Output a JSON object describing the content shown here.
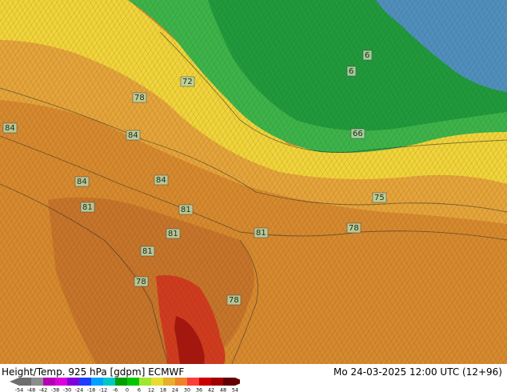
{
  "caption": "Height/Temp. 925 hPa [gdpm] ECMWF",
  "valid_time": "Mo 24-03-2025 12:00 UTC (12+96)",
  "legend": {
    "ticks": [
      "-54",
      "-48",
      "-42",
      "-38",
      "-30",
      "-24",
      "-18",
      "-12",
      "-6",
      "0",
      "6",
      "12",
      "18",
      "24",
      "30",
      "36",
      "42",
      "48",
      "54"
    ],
    "colors": [
      "#6e6e6e",
      "#8c8c8c",
      "#b400b4",
      "#dc00dc",
      "#8200dc",
      "#1e3cff",
      "#00a0ff",
      "#00c8c8",
      "#00a000",
      "#00c800",
      "#a0e632",
      "#e6dc32",
      "#e6af2d",
      "#f08228",
      "#fa3c3c",
      "#c80000",
      "#a00000",
      "#640000"
    ]
  },
  "map": {
    "colors": {
      "cold_blue": "#4f8fbf",
      "green_dark": "#1f9a3c",
      "green": "#3cb44a",
      "yellow": "#f2d43a",
      "orange_light": "#e6a43a",
      "orange": "#d8892e",
      "orange_dark": "#c8742a",
      "red": "#d23a1e",
      "red_dark": "#a8150f"
    },
    "contour_labels": [
      {
        "text": "6"
      },
      {
        "text": "6"
      },
      {
        "text": "72"
      },
      {
        "text": "78"
      },
      {
        "text": "84"
      },
      {
        "text": "84"
      },
      {
        "text": "84"
      },
      {
        "text": "84"
      },
      {
        "text": "81"
      },
      {
        "text": "81"
      },
      {
        "text": "81"
      },
      {
        "text": "81"
      },
      {
        "text": "81"
      },
      {
        "text": "78"
      },
      {
        "text": "78"
      },
      {
        "text": "78"
      },
      {
        "text": "75"
      },
      {
        "text": "66"
      }
    ]
  }
}
